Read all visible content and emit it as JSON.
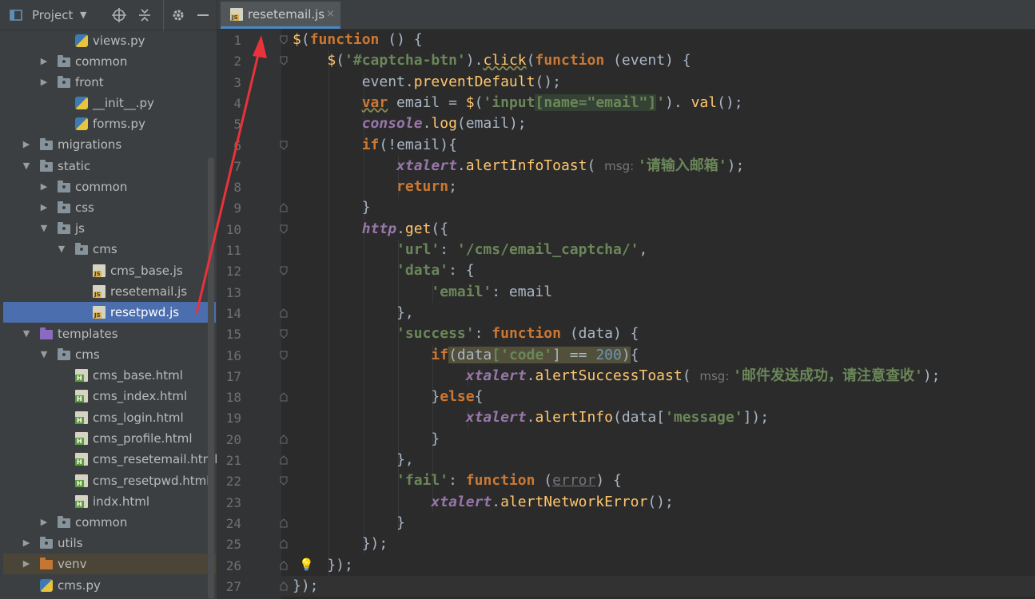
{
  "project_panel": {
    "title": "Project",
    "icons": [
      "window-icon",
      "chevron-down-icon",
      "target-icon",
      "collapse-icon",
      "gear-icon",
      "minimize-icon"
    ],
    "tree": [
      {
        "label": "views.py",
        "type": "py",
        "depth": 4,
        "expanded": null
      },
      {
        "label": "common",
        "type": "folder",
        "depth": 3,
        "expanded": false
      },
      {
        "label": "front",
        "type": "folder",
        "depth": 3,
        "expanded": false
      },
      {
        "label": "__init__.py",
        "type": "py",
        "depth": 4,
        "expanded": null
      },
      {
        "label": "forms.py",
        "type": "py",
        "depth": 4,
        "expanded": null
      },
      {
        "label": "migrations",
        "type": "folder",
        "depth": 2,
        "expanded": false
      },
      {
        "label": "static",
        "type": "folder",
        "depth": 2,
        "expanded": true
      },
      {
        "label": "common",
        "type": "folder",
        "depth": 3,
        "expanded": false
      },
      {
        "label": "css",
        "type": "folder",
        "depth": 3,
        "expanded": false
      },
      {
        "label": "js",
        "type": "folder",
        "depth": 3,
        "expanded": true
      },
      {
        "label": "cms",
        "type": "folder",
        "depth": 4,
        "expanded": true
      },
      {
        "label": "cms_base.js",
        "type": "js",
        "depth": 5,
        "expanded": null
      },
      {
        "label": "resetemail.js",
        "type": "js",
        "depth": 5,
        "expanded": null
      },
      {
        "label": "resetpwd.js",
        "type": "js",
        "depth": 5,
        "expanded": null,
        "selected": true
      },
      {
        "label": "templates",
        "type": "folder-purple",
        "depth": 2,
        "expanded": true
      },
      {
        "label": "cms",
        "type": "folder",
        "depth": 3,
        "expanded": true
      },
      {
        "label": "cms_base.html",
        "type": "html",
        "depth": 4,
        "expanded": null
      },
      {
        "label": "cms_index.html",
        "type": "html",
        "depth": 4,
        "expanded": null
      },
      {
        "label": "cms_login.html",
        "type": "html",
        "depth": 4,
        "expanded": null
      },
      {
        "label": "cms_profile.html",
        "type": "html",
        "depth": 4,
        "expanded": null
      },
      {
        "label": "cms_resetemail.html",
        "type": "html",
        "depth": 4,
        "expanded": null
      },
      {
        "label": "cms_resetpwd.html",
        "type": "html",
        "depth": 4,
        "expanded": null
      },
      {
        "label": "indx.html",
        "type": "html",
        "depth": 4,
        "expanded": null
      },
      {
        "label": "common",
        "type": "folder",
        "depth": 3,
        "expanded": false
      },
      {
        "label": "utils",
        "type": "folder",
        "depth": 2,
        "expanded": false
      },
      {
        "label": "venv",
        "type": "folder-orange",
        "depth": 2,
        "expanded": false,
        "excluded": true
      },
      {
        "label": "cms.py",
        "type": "py",
        "depth": 2,
        "expanded": null
      }
    ]
  },
  "editor": {
    "tab": {
      "label": "resetemail.js",
      "icon": "js-file-icon",
      "close": "×"
    },
    "current_line": 27,
    "lines": [
      [
        [
          "f",
          "$"
        ],
        [
          "p",
          "("
        ],
        [
          "k",
          "function"
        ],
        [
          "p",
          " () {"
        ]
      ],
      [
        [
          "p",
          "    "
        ],
        [
          "f",
          "$"
        ],
        [
          "p",
          "("
        ],
        [
          "s",
          "'#captcha-btn'"
        ],
        [
          "p",
          ")."
        ],
        [
          "f",
          "click"
        ],
        [
          "p",
          "("
        ],
        [
          "k",
          "function"
        ],
        [
          "p",
          " (event) {"
        ]
      ],
      [
        [
          "p",
          "        event."
        ],
        [
          "f",
          "preventDefault"
        ],
        [
          "p",
          "();"
        ]
      ],
      [
        [
          "p",
          "        "
        ],
        [
          "k",
          "var"
        ],
        [
          "p",
          " email = "
        ],
        [
          "f",
          "$"
        ],
        [
          "p",
          "("
        ],
        [
          "s",
          "'input"
        ],
        [
          "sb",
          "[name=\"email\"]"
        ],
        [
          "s",
          "'"
        ],
        [
          "p",
          "). "
        ],
        [
          "f",
          "val"
        ],
        [
          "p",
          "();"
        ]
      ],
      [
        [
          "p",
          "        "
        ],
        [
          "v",
          "console"
        ],
        [
          "p",
          "."
        ],
        [
          "f",
          "log"
        ],
        [
          "p",
          "(email);"
        ]
      ],
      [
        [
          "p",
          "        "
        ],
        [
          "k",
          "if"
        ],
        [
          "p",
          "(!email){"
        ]
      ],
      [
        [
          "p",
          "            "
        ],
        [
          "v",
          "xtalert"
        ],
        [
          "p",
          "."
        ],
        [
          "f",
          "alertInfoToast"
        ],
        [
          "p",
          "( "
        ],
        [
          "h",
          "msg: "
        ],
        [
          "s",
          "'请输入邮箱'"
        ],
        [
          "p",
          ");"
        ]
      ],
      [
        [
          "p",
          "            "
        ],
        [
          "k",
          "return"
        ],
        [
          "p",
          ";"
        ]
      ],
      [
        [
          "p",
          "        }"
        ]
      ],
      [
        [
          "p",
          "        "
        ],
        [
          "v",
          "http"
        ],
        [
          "p",
          "."
        ],
        [
          "f",
          "get"
        ],
        [
          "p",
          "({"
        ]
      ],
      [
        [
          "p",
          "            "
        ],
        [
          "s",
          "'url'"
        ],
        [
          "p",
          ": "
        ],
        [
          "s",
          "'/cms/email_captcha/'"
        ],
        [
          "p",
          ","
        ]
      ],
      [
        [
          "p",
          "            "
        ],
        [
          "s",
          "'data'"
        ],
        [
          "p",
          ": {"
        ]
      ],
      [
        [
          "p",
          "                "
        ],
        [
          "s",
          "'email'"
        ],
        [
          "p",
          ": email"
        ]
      ],
      [
        [
          "p",
          "            },"
        ]
      ],
      [
        [
          "p",
          "            "
        ],
        [
          "s",
          "'success'"
        ],
        [
          "p",
          ": "
        ],
        [
          "k",
          "function"
        ],
        [
          "p",
          " (data) {"
        ]
      ],
      [
        [
          "p",
          "                "
        ],
        [
          "k",
          "if"
        ],
        [
          "hl",
          "(data"
        ],
        [
          "hls",
          "['code'"
        ],
        [
          "hl",
          "] == "
        ],
        [
          "hln",
          "200"
        ],
        [
          "hl",
          ")"
        ],
        [
          "p",
          "{"
        ]
      ],
      [
        [
          "p",
          "                    "
        ],
        [
          "v",
          "xtalert"
        ],
        [
          "p",
          "."
        ],
        [
          "f",
          "alertSuccessToast"
        ],
        [
          "p",
          "( "
        ],
        [
          "h",
          "msg: "
        ],
        [
          "s",
          "'邮件发送成功，请注意查收'"
        ],
        [
          "p",
          ");"
        ]
      ],
      [
        [
          "p",
          "                }"
        ],
        [
          "k",
          "else"
        ],
        [
          "p",
          "{"
        ]
      ],
      [
        [
          "p",
          "                    "
        ],
        [
          "v",
          "xtalert"
        ],
        [
          "p",
          "."
        ],
        [
          "f",
          "alertInfo"
        ],
        [
          "p",
          "(data["
        ],
        [
          "s",
          "'message'"
        ],
        [
          "p",
          "]);"
        ]
      ],
      [
        [
          "p",
          "                }"
        ]
      ],
      [
        [
          "p",
          "            },"
        ]
      ],
      [
        [
          "p",
          "            "
        ],
        [
          "s",
          "'fail'"
        ],
        [
          "p",
          ": "
        ],
        [
          "k",
          "function"
        ],
        [
          "p",
          " ("
        ],
        [
          "e",
          "error"
        ],
        [
          "p",
          ") {"
        ]
      ],
      [
        [
          "p",
          "                "
        ],
        [
          "v",
          "xtalert"
        ],
        [
          "p",
          "."
        ],
        [
          "f",
          "alertNetworkError"
        ],
        [
          "p",
          "();"
        ]
      ],
      [
        [
          "p",
          "            }"
        ]
      ],
      [
        [
          "p",
          "        });"
        ]
      ],
      [
        [
          "p",
          "    });"
        ]
      ],
      [
        [
          "p",
          "});"
        ]
      ]
    ],
    "bulb_icon": "lightbulb-icon",
    "annotation_icon": "red-arrow-icon"
  }
}
